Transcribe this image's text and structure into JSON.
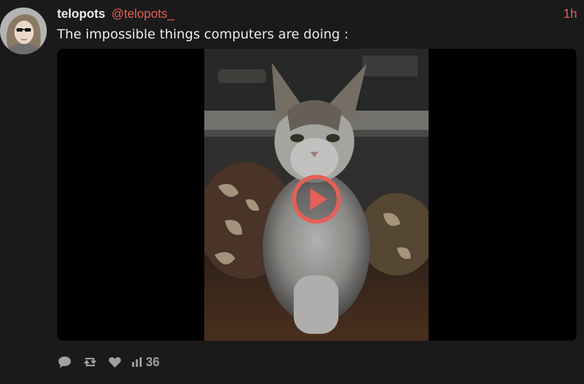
{
  "post": {
    "author": {
      "display_name": "telopots",
      "handle": "@telopots_"
    },
    "timestamp": "1h",
    "text": "The impossible things computers are doing :",
    "views": "36"
  },
  "icons": {
    "reply": "speech-bubble-icon",
    "repost": "repost-arrows-icon",
    "like": "heart-icon",
    "views": "bar-chart-icon",
    "play": "play-icon"
  },
  "colors": {
    "background": "#1a1a1a",
    "accent": "#e55f58",
    "text": "#ececec",
    "muted": "#a0a0a0"
  }
}
